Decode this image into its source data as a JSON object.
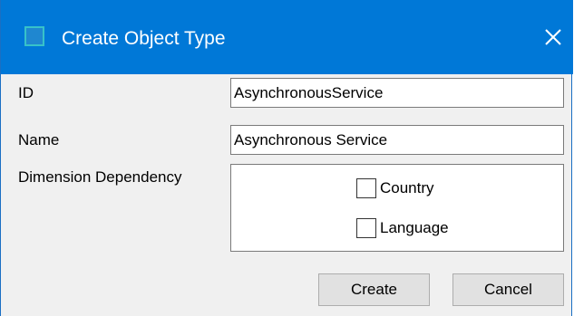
{
  "window": {
    "title": "Create Object Type",
    "close_glyph": "✕"
  },
  "form": {
    "id_label": "ID",
    "id_value": "AsynchronousService",
    "name_label": "Name",
    "name_value": "Asynchronous Service",
    "dimension_label": "Dimension Dependency",
    "dimensions": [
      {
        "label": "Country",
        "checked": false
      },
      {
        "label": "Language",
        "checked": false
      }
    ]
  },
  "buttons": {
    "create_label": "Create",
    "cancel_label": "Cancel"
  },
  "colors": {
    "titlebar": "#0078d7",
    "dialog_background": "#f0f0f0",
    "icon_border": "#37c2c9"
  }
}
